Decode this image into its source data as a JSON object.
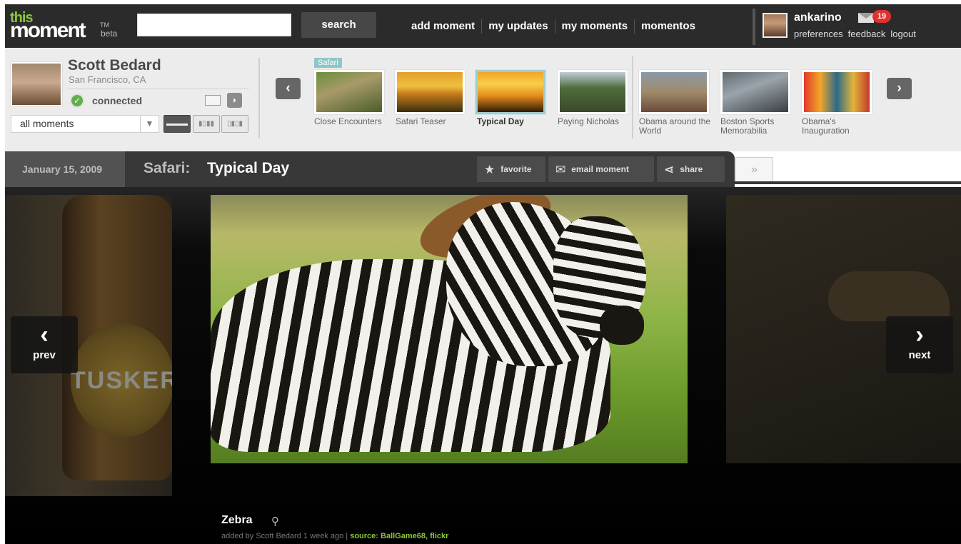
{
  "header": {
    "logo_top": "this",
    "logo_main": "moment",
    "logo_tm": "TM",
    "logo_beta": "beta",
    "search_button": "search",
    "search_value": "",
    "nav": [
      "add moment",
      "my updates",
      "my moments",
      "momentos"
    ],
    "user": {
      "name": "ankarino",
      "mail_count": "19",
      "links": [
        "preferences",
        "feedback",
        "logout"
      ]
    }
  },
  "profile": {
    "name": "Scott Bedard",
    "location": "San Francisco, CA",
    "status": "connected",
    "filter_selected": "all moments"
  },
  "strip": {
    "tag": "Safari",
    "thumbnails": [
      {
        "label": "Close Encounters",
        "active": false
      },
      {
        "label": "Safari Teaser",
        "active": false
      },
      {
        "label": "Typical Day",
        "active": true
      },
      {
        "label": "Paying Nicholas",
        "active": false
      },
      {
        "label": "Obama around the World",
        "active": false
      },
      {
        "label": "Boston Sports Memorabilia",
        "active": false
      },
      {
        "label": "Obama's Inauguration",
        "active": false
      }
    ]
  },
  "moment": {
    "date": "January 15, 2009",
    "category": "Safari:",
    "title": "Typical Day",
    "actions": [
      "favorite",
      "email moment",
      "share"
    ],
    "more": "»"
  },
  "viewer": {
    "prev_label": "prev",
    "next_label": "next",
    "left_bottle_text": "TUSKER",
    "caption": "Zebra",
    "added_by": "added by Scott Bedard 1 week ago |",
    "source": "source: BallGame68, flickr"
  },
  "colors": {
    "brand_green": "#8cc63f",
    "topbar": "#2b2b2b",
    "accent_teal": "#9bcfd3",
    "badge_red": "#e03030"
  }
}
